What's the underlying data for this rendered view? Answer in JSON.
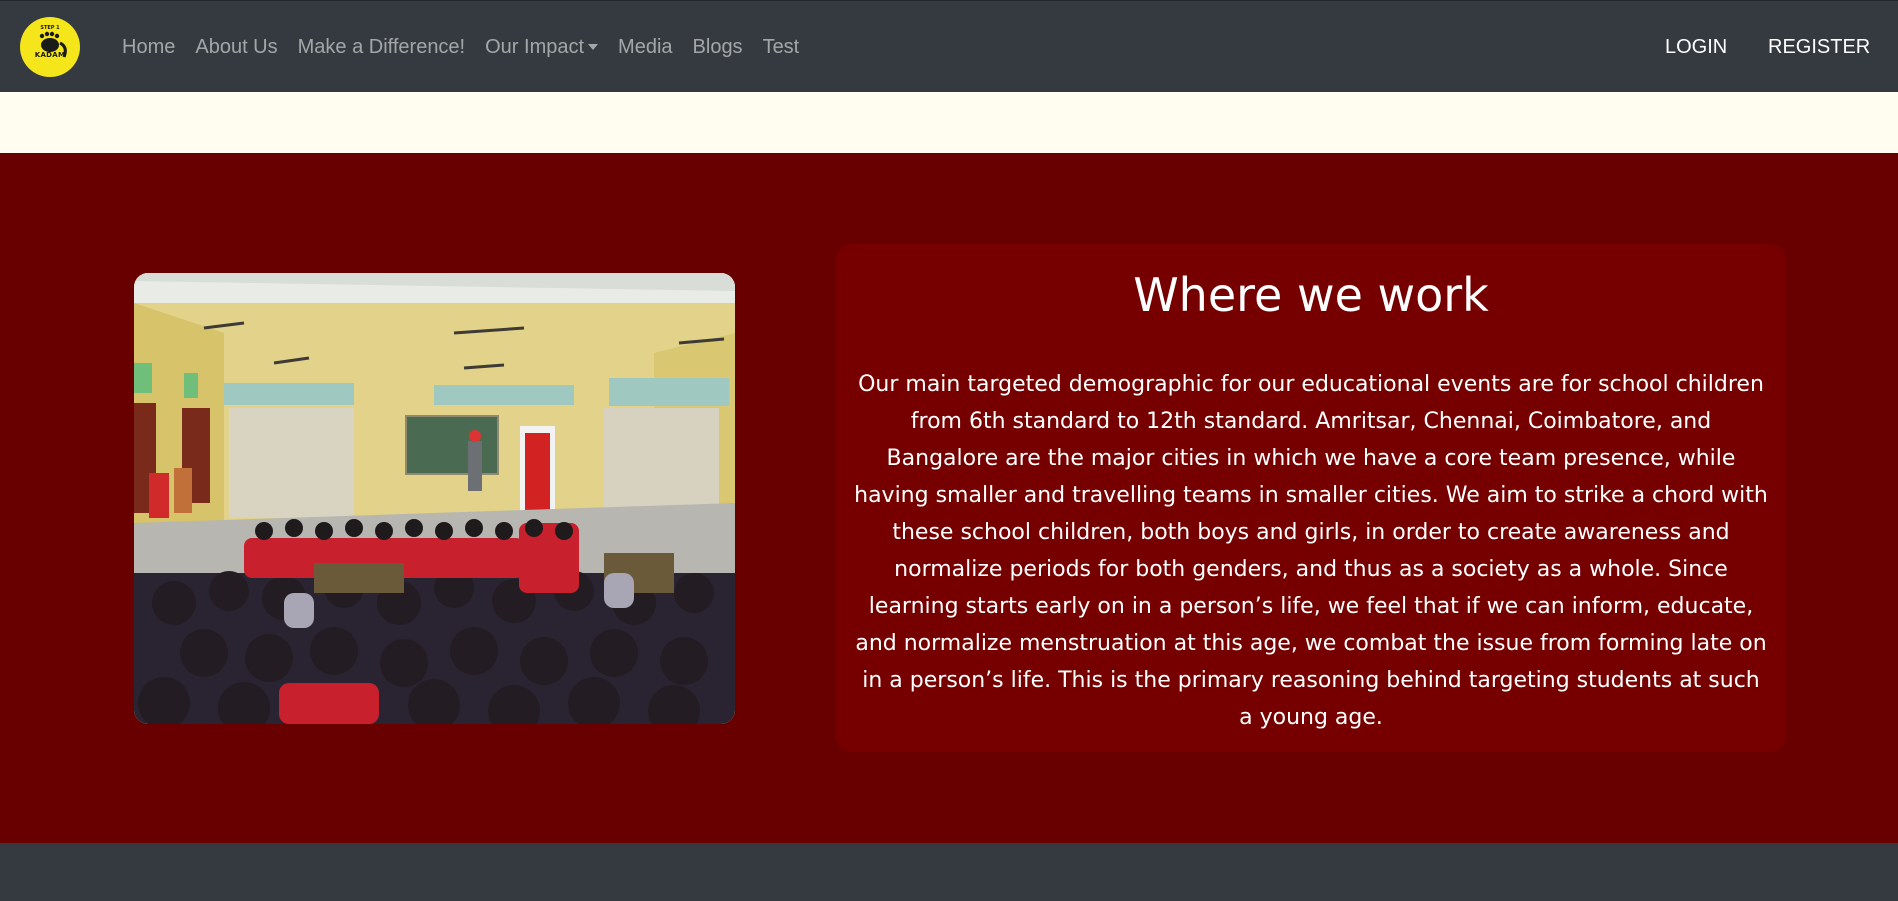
{
  "brand": {
    "logo_top_text": "STEP 1",
    "logo_text": "KADAM"
  },
  "nav": {
    "items": [
      {
        "label": "Home"
      },
      {
        "label": "About Us"
      },
      {
        "label": "Make a Difference!"
      },
      {
        "label": "Our Impact",
        "dropdown": true
      },
      {
        "label": "Media"
      },
      {
        "label": "Blogs"
      },
      {
        "label": "Test"
      }
    ],
    "login": "LOGIN",
    "register": "REGISTER"
  },
  "section": {
    "heading": "Where we work",
    "body": "Our main targeted demographic for our educational events are for school children from 6th standard to 12th standard. Amritsar, Chennai, Coimbatore, and Bangalore are the major cities in which we have a core team presence, while having smaller and travelling teams in smaller cities. We aim to strike a chord with these school children, both boys and girls, in order to create awareness and normalize periods for both genders, and thus as a society as a whole. Since learning starts early on in a person’s life, we feel that if we can inform, educate, and normalize menstruation at this age, we combat the issue from forming late on in a person’s life. This is the primary reasoning behind targeting students at such a young age."
  },
  "colors": {
    "navbar": "#343a40",
    "cream": "#fffdf0",
    "maroon": "#690000",
    "card": "#760000",
    "logo_yellow": "#f5e61c"
  }
}
